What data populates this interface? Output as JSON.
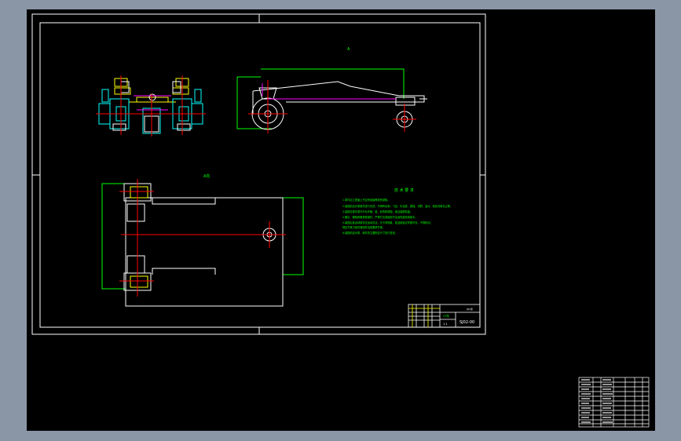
{
  "drawing": {
    "label_a": "A",
    "label_b": "A向",
    "tech_title": "技 术 要 求",
    "tech_notes": [
      "1.零件加工表面上不应有划痕等损伤缺陷。",
      "2.装配前应对零部件进行清洗，不得有毛刺、飞边、氧化皮、锈蚀、切屑、油污、着色剂和灰尘等。",
      "3.装配过程中零件不允许磕、碰、划伤和锈蚀，保证装配精度。",
      "4.螺钉、螺栓和螺母紧固时，严禁打击或使用不合适的旋具和扳手。",
      "5.装配后各运动部件应运动灵活，无卡滞现象，各连接处应牢固可靠，不得松动；",
      "   规定拧紧力矩的紧固件应按要求拧紧。",
      "6.装配前应对零、部件的主要配合尺寸进行复查。"
    ],
    "title_block": {
      "drawing_no": "SJ02-00",
      "name": "小车",
      "scale": "1:1",
      "sheet": "共1张"
    }
  },
  "bom": {
    "rows": 10
  },
  "colors": {
    "background": "#000000",
    "frame": "#ffffff",
    "outline": "#ffffff",
    "dimension": "#00ff00",
    "center": "#ff0000",
    "hidden": "#ff00ff",
    "section": "#00ffff",
    "yellow": "#ffff00"
  }
}
